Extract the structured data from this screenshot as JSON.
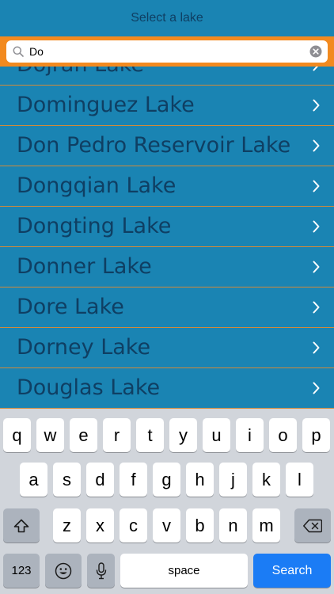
{
  "nav": {
    "title": "Select a lake"
  },
  "search": {
    "value": "Do",
    "placeholder": ""
  },
  "lakes": [
    "Dojran Lake",
    "Dominguez Lake",
    "Don Pedro Reservoir Lake",
    "Dongqian Lake",
    "Dongting Lake",
    "Donner Lake",
    "Dore Lake",
    "Dorney Lake",
    "Douglas Lake"
  ],
  "keyboard": {
    "row1": [
      "q",
      "w",
      "e",
      "r",
      "t",
      "y",
      "u",
      "i",
      "o",
      "p"
    ],
    "row2": [
      "a",
      "s",
      "d",
      "f",
      "g",
      "h",
      "j",
      "k",
      "l"
    ],
    "row3": [
      "z",
      "x",
      "c",
      "v",
      "b",
      "n",
      "m"
    ],
    "numbers_label": "123",
    "space_label": "space",
    "search_label": "Search"
  },
  "icons": {
    "search": "magnifier-icon",
    "clear": "clear-circle-icon",
    "chevron": "chevron-right-icon",
    "shift": "shift-arrow-icon",
    "delete": "backspace-icon",
    "emoji": "smiley-icon",
    "mic": "microphone-icon"
  },
  "colors": {
    "list_bg": "#1a84b3",
    "text": "#0f3f63",
    "search_bar": "#f28a1f",
    "separator": "#d08a3a",
    "search_key": "#1b7cf5"
  }
}
